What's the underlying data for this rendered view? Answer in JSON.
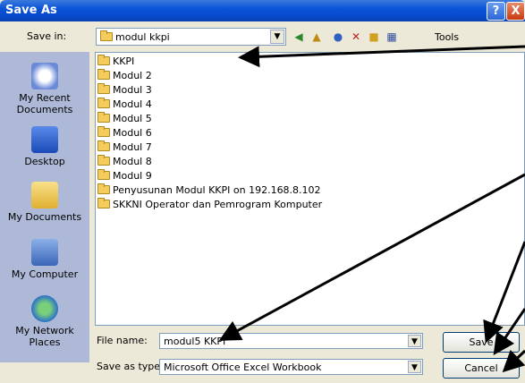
{
  "window": {
    "title": "Save As",
    "help": "?",
    "close": "X"
  },
  "save_in": {
    "label": "Save in:",
    "value": "modul kkpi"
  },
  "toolbar": {
    "tools_label": "Tools"
  },
  "places": [
    {
      "label": "My Recent Documents",
      "icon": "recent-documents-icon"
    },
    {
      "label": "Desktop",
      "icon": "desktop-icon"
    },
    {
      "label": "My Documents",
      "icon": "my-documents-icon"
    },
    {
      "label": "My Computer",
      "icon": "my-computer-icon"
    },
    {
      "label": "My Network Places",
      "icon": "network-places-icon"
    }
  ],
  "files": [
    "KKPI",
    "Modul 2",
    "Modul 3",
    "Modul 4",
    "Modul 5",
    "Modul 6",
    "Modul 7",
    "Modul 8",
    "Modul 9",
    "Penyusunan Modul KKPI on 192.168.8.102",
    "SKKNI Operator dan Pemrogram Komputer"
  ],
  "file_name": {
    "label": "File name:",
    "value": "modul5 KKPI"
  },
  "save_as_type": {
    "label": "Save as type:",
    "value": "Microsoft Office Excel Workbook"
  },
  "buttons": {
    "save": "Save",
    "cancel": "Cancel"
  },
  "colors": {
    "title_bar": "#0a53d8",
    "places_bar": "#aeb9d7",
    "dialog": "#ece9d8"
  }
}
